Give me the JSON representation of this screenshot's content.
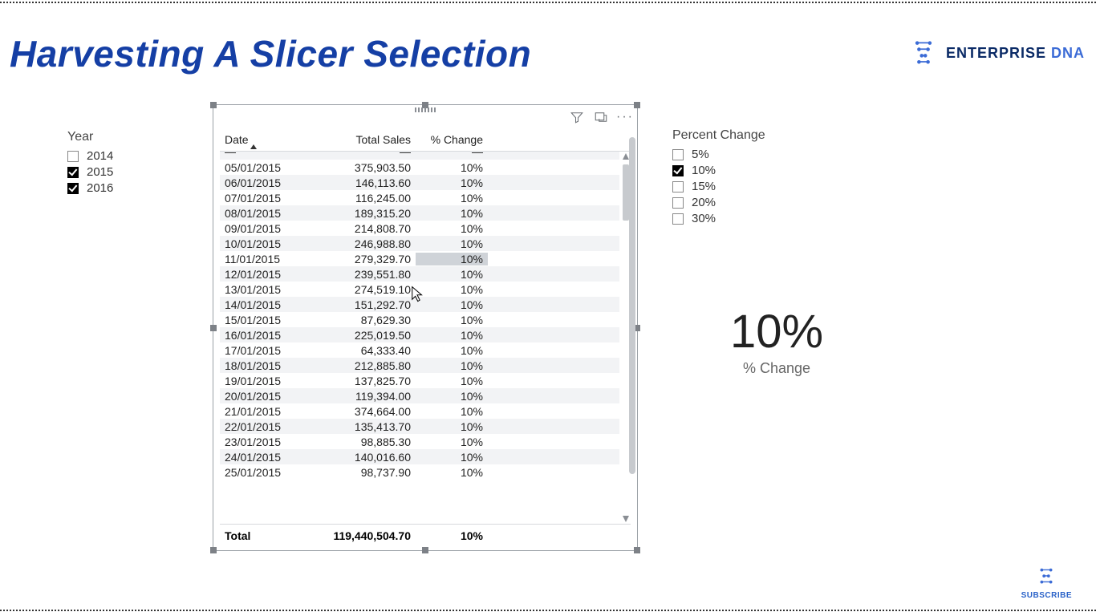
{
  "page_title": "Harvesting A Slicer Selection",
  "brand": {
    "name_a": "ENTERPRISE",
    "name_b": "DNA"
  },
  "subscribe_label": "SUBSCRIBE",
  "year_slicer": {
    "title": "Year",
    "items": [
      {
        "label": "2014",
        "checked": false
      },
      {
        "label": "2015",
        "checked": true
      },
      {
        "label": "2016",
        "checked": true
      }
    ]
  },
  "pct_slicer": {
    "title": "Percent Change",
    "items": [
      {
        "label": "5%",
        "checked": false
      },
      {
        "label": "10%",
        "checked": true
      },
      {
        "label": "15%",
        "checked": false
      },
      {
        "label": "20%",
        "checked": false
      },
      {
        "label": "30%",
        "checked": false
      }
    ]
  },
  "card": {
    "value": "10%",
    "label": "% Change"
  },
  "table": {
    "columns": [
      "Date",
      "Total Sales",
      "% Change"
    ],
    "rows": [
      {
        "date": "05/01/2015",
        "sales": "375,903.50",
        "pct": "10%"
      },
      {
        "date": "06/01/2015",
        "sales": "146,113.60",
        "pct": "10%"
      },
      {
        "date": "07/01/2015",
        "sales": "116,245.00",
        "pct": "10%"
      },
      {
        "date": "08/01/2015",
        "sales": "189,315.20",
        "pct": "10%"
      },
      {
        "date": "09/01/2015",
        "sales": "214,808.70",
        "pct": "10%"
      },
      {
        "date": "10/01/2015",
        "sales": "246,988.80",
        "pct": "10%"
      },
      {
        "date": "11/01/2015",
        "sales": "279,329.70",
        "pct": "10%",
        "highlight_pct": true
      },
      {
        "date": "12/01/2015",
        "sales": "239,551.80",
        "pct": "10%"
      },
      {
        "date": "13/01/2015",
        "sales": "274,519.10",
        "pct": "10%"
      },
      {
        "date": "14/01/2015",
        "sales": "151,292.70",
        "pct": "10%"
      },
      {
        "date": "15/01/2015",
        "sales": "87,629.30",
        "pct": "10%"
      },
      {
        "date": "16/01/2015",
        "sales": "225,019.50",
        "pct": "10%"
      },
      {
        "date": "17/01/2015",
        "sales": "64,333.40",
        "pct": "10%"
      },
      {
        "date": "18/01/2015",
        "sales": "212,885.80",
        "pct": "10%"
      },
      {
        "date": "19/01/2015",
        "sales": "137,825.70",
        "pct": "10%"
      },
      {
        "date": "20/01/2015",
        "sales": "119,394.00",
        "pct": "10%"
      },
      {
        "date": "21/01/2015",
        "sales": "374,664.00",
        "pct": "10%"
      },
      {
        "date": "22/01/2015",
        "sales": "135,413.70",
        "pct": "10%"
      },
      {
        "date": "23/01/2015",
        "sales": "98,885.30",
        "pct": "10%"
      },
      {
        "date": "24/01/2015",
        "sales": "140,016.60",
        "pct": "10%"
      },
      {
        "date": "25/01/2015",
        "sales": "98,737.90",
        "pct": "10%"
      }
    ],
    "total": {
      "label": "Total",
      "sales": "119,440,504.70",
      "pct": "10%"
    }
  }
}
